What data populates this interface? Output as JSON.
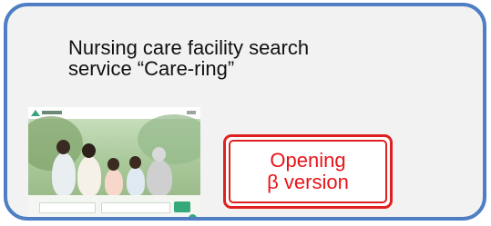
{
  "card": {
    "title_line1": "Nursing care facility search",
    "title_line2": "service “Care-ring”"
  },
  "badge": {
    "line1": "Opening",
    "line2": "β version"
  },
  "colors": {
    "card_border": "#4f7ec4",
    "card_background": "#f2f2f2",
    "badge_red": "#e02020",
    "site_green": "#36a97a"
  },
  "thumbnail": {
    "description_icon": "website-screenshot-image"
  }
}
